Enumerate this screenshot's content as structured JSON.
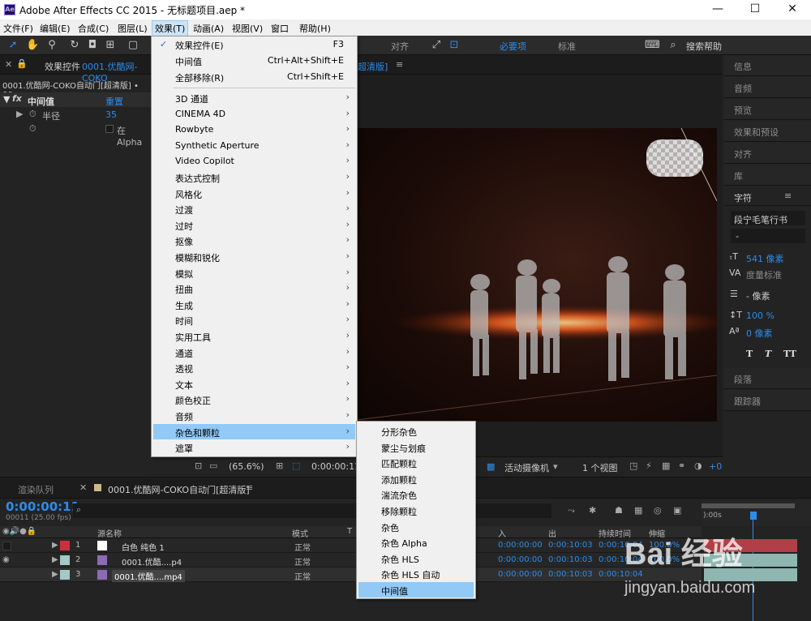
{
  "window": {
    "title": "Adobe After Effects CC 2015 - 无标题项目.aep *",
    "logo": "Ae",
    "minimize": "—",
    "maximize": "☐",
    "close": "✕"
  },
  "menubar": [
    "文件(F)",
    "编辑(E)",
    "合成(C)",
    "图层(L)",
    "效果(T)",
    "动画(A)",
    "视图(V)",
    "窗口",
    "帮助(H)"
  ],
  "toolbar": {
    "align_label": "对齐",
    "workspace_essentials": "必要项",
    "workspace_standard": "标准",
    "search_help": "搜索帮助"
  },
  "effects_panel": {
    "tab_label": "效果控件",
    "tab_source": "0001.优酷网-COKO",
    "path": "0001.优酷网-COKO自动门[超清版] • 00",
    "effect_name": "中间值",
    "reset": "重置",
    "param_radius": "半径",
    "param_radius_value": "35",
    "param_alpha": "在 Alpha"
  },
  "comp_tab": "超清版]",
  "effects_menu": {
    "top": [
      {
        "label": "效果控件(E)",
        "shortcut": "F3",
        "checked": "✓"
      },
      {
        "label": "中间值",
        "shortcut": "Ctrl+Alt+Shift+E"
      },
      {
        "label": "全部移除(R)",
        "shortcut": "Ctrl+Shift+E"
      }
    ],
    "categories": [
      "3D 通道",
      "CINEMA 4D",
      "Rowbyte",
      "Synthetic Aperture",
      "Video Copilot",
      "表达式控制",
      "风格化",
      "过渡",
      "过时",
      "抠像",
      "模糊和锐化",
      "模拟",
      "扭曲",
      "生成",
      "时间",
      "实用工具",
      "通道",
      "透视",
      "文本",
      "颜色校正",
      "音频",
      "杂色和颗粒",
      "遮罩"
    ],
    "highlighted": "杂色和颗粒"
  },
  "noise_submenu": {
    "items": [
      "分形杂色",
      "蒙尘与划痕",
      "匹配颗粒",
      "添加颗粒",
      "湍流杂色",
      "移除颗粒",
      "杂色",
      "杂色 Alpha",
      "杂色 HLS",
      "杂色 HLS 自动",
      "中间值"
    ],
    "highlighted": "中间值"
  },
  "right_panel": {
    "items": [
      "信息",
      "音频",
      "预览",
      "效果和预设",
      "对齐",
      "库"
    ],
    "character_title": "字符",
    "font_name": "段宁毛笔行书",
    "font_style": "-",
    "font_size": "541 像素",
    "tracking": "度量标准",
    "leading": "- 像素",
    "vert_scale": "100 %",
    "baseline": "0 像素",
    "text_buttons": [
      "T",
      "T",
      "TT"
    ],
    "paragraph": "段落",
    "tracker": "跟踪器"
  },
  "viewer_bar": {
    "zoom": "(65.6%)",
    "timecode": "0:00:00:11",
    "camera": "活动摄像机",
    "views": "1 个视图",
    "offset": "+0"
  },
  "timeline": {
    "render_queue_tab": "渲染队列",
    "comp_tab": "0001.优酷网-COKO自动门[超清版]",
    "current_time": "0:00:00:11",
    "frame_info": "00011 (25.00 fps)",
    "search_icon": "⌕",
    "columns": {
      "source": "源名称",
      "mode": "模式",
      "t": "T",
      "in": "入",
      "out": "出",
      "duration": "持续时间",
      "stretch": "伸缩"
    },
    "ruler_start": "):00s",
    "layers": [
      {
        "num": "1",
        "name": "白色 纯色 1",
        "mode": "正常",
        "in": "0:00:00:00",
        "out": "0:00:10:03",
        "dur": "0:00:10:04",
        "stretch": "100.0%",
        "color": "#c8323c"
      },
      {
        "num": "2",
        "name": "0001.优酷....p4",
        "mode": "正常",
        "in": "0:00:00:00",
        "out": "0:00:10:03",
        "dur": "0:00:10:04",
        "stretch": "100.0%",
        "color": "#a3c9c4"
      },
      {
        "num": "3",
        "name": "0001.优酷....mp4",
        "mode": "正常",
        "in": "0:00:00:00",
        "out": "0:00:10:03",
        "dur": "0:00:10:04",
        "stretch": "",
        "color": "#a3c9c4"
      }
    ]
  },
  "watermark": {
    "brand": "Bai 经验",
    "url": "jingyan.baidu.com"
  }
}
